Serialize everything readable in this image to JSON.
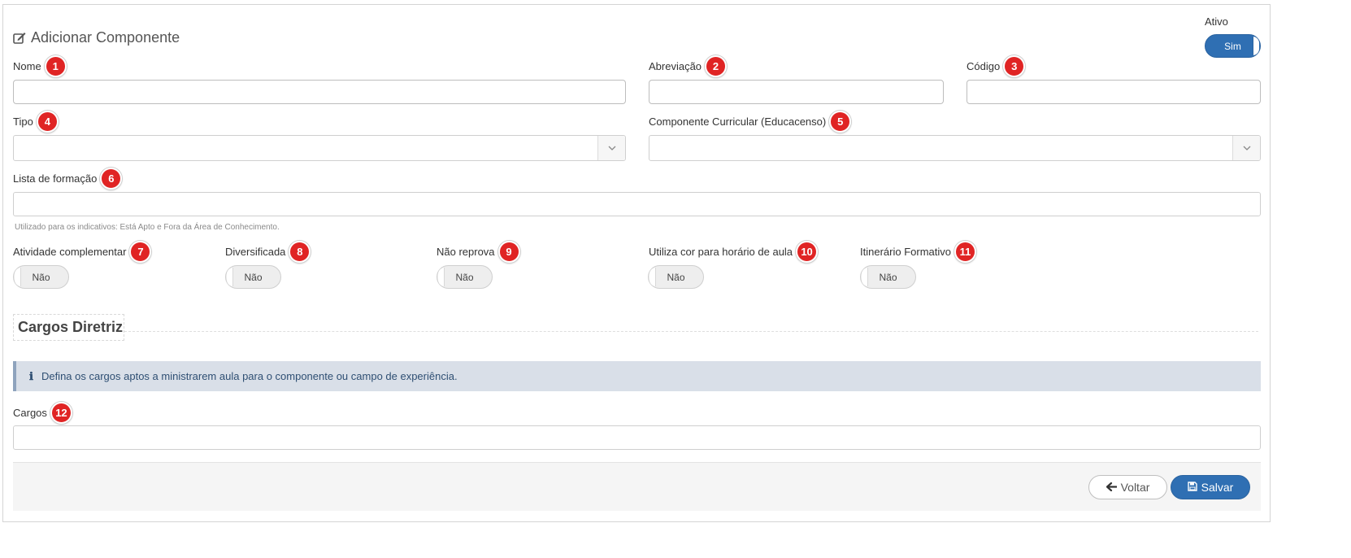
{
  "form": {
    "title": "Adicionar Componente",
    "active": {
      "label": "Ativo",
      "value": "Sim"
    }
  },
  "fields": {
    "nome": {
      "label": "Nome",
      "badge": "1",
      "value": ""
    },
    "abreviacao": {
      "label": "Abreviação",
      "badge": "2",
      "value": ""
    },
    "codigo": {
      "label": "Código",
      "badge": "3",
      "value": ""
    },
    "tipo": {
      "label": "Tipo",
      "badge": "4",
      "value": ""
    },
    "componente_curricular": {
      "label": "Componente Curricular (Educacenso)",
      "badge": "5",
      "value": ""
    },
    "lista_formacao": {
      "label": "Lista de formação",
      "badge": "6",
      "value": "",
      "help": "Utilizado para os indicativos: Está Apto e Fora da Área de Conhecimento."
    }
  },
  "toggles": [
    {
      "label": "Atividade complementar",
      "badge": "7",
      "value": "Não"
    },
    {
      "label": "Diversificada",
      "badge": "8",
      "value": "Não"
    },
    {
      "label": "Não reprova",
      "badge": "9",
      "value": "Não"
    },
    {
      "label": "Utiliza cor para horário de aula",
      "badge": "10",
      "value": "Não"
    },
    {
      "label": "Itinerário Formativo",
      "badge": "11",
      "value": "Não"
    }
  ],
  "section": {
    "title": "Cargos Diretriz",
    "info_icon": "info-icon",
    "info_text": "Defina os cargos aptos a ministrarem aula para o componente ou campo de experiência."
  },
  "cargos": {
    "label": "Cargos",
    "badge": "12",
    "value": ""
  },
  "buttons": {
    "back": "Voltar",
    "save": "Salvar"
  },
  "colors": {
    "primary": "#2f6fb3",
    "badge": "#e02424",
    "info_bg": "#d9dfe8"
  }
}
